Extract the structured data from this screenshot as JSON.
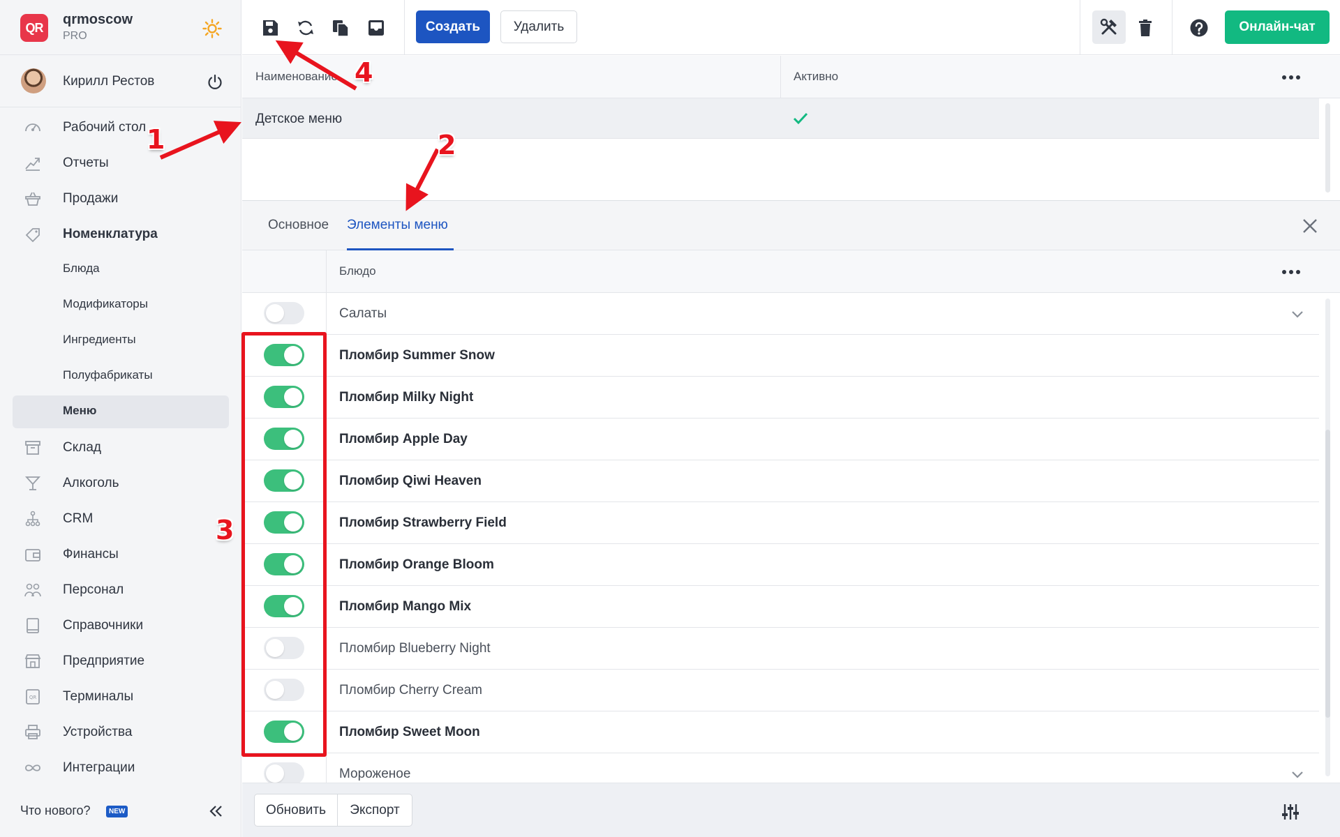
{
  "brand": {
    "logo_text": "QR",
    "name": "qrmoscow",
    "plan": "PRO"
  },
  "user": {
    "name": "Кирилл Рестов"
  },
  "nav": {
    "items": [
      {
        "label": "Рабочий стол",
        "icon": "dashboard-gauge-icon"
      },
      {
        "label": "Отчеты",
        "icon": "chart-trend-icon"
      },
      {
        "label": "Продажи",
        "icon": "basket-icon"
      },
      {
        "label": "Номенклатура",
        "icon": "tag-icon"
      }
    ],
    "sub": [
      "Блюда",
      "Модификаторы",
      "Ингредиенты",
      "Полуфабрикаты",
      "Меню"
    ],
    "active_sub": "Меню",
    "items_after": [
      {
        "label": "Склад",
        "icon": "archive-icon"
      },
      {
        "label": "Алкоголь",
        "icon": "cocktail-icon"
      },
      {
        "label": "CRM",
        "icon": "hierarchy-icon"
      },
      {
        "label": "Финансы",
        "icon": "wallet-icon"
      },
      {
        "label": "Персонал",
        "icon": "people-icon"
      },
      {
        "label": "Справочники",
        "icon": "book-icon"
      },
      {
        "label": "Предприятие",
        "icon": "store-icon"
      },
      {
        "label": "Терминалы",
        "icon": "qr-terminal-icon"
      },
      {
        "label": "Устройства",
        "icon": "printer-icon"
      },
      {
        "label": "Интеграции",
        "icon": "infinity-icon"
      }
    ],
    "whats_new": "Что нового?",
    "new_badge": "NEW"
  },
  "toolbar": {
    "create_label": "Создать",
    "delete_label": "Удалить",
    "chat_label": "Онлайн-чат"
  },
  "top_grid": {
    "columns": [
      "Наименование",
      "Активно"
    ],
    "rows": [
      {
        "name": "Детское меню",
        "active": true
      }
    ]
  },
  "detail": {
    "tabs": [
      "Основное",
      "Элементы меню"
    ],
    "active_tab": 1,
    "column": "Блюдо",
    "rows": [
      {
        "name": "Салаты",
        "enabled": false,
        "group": true
      },
      {
        "name": "Пломбир Summer Snow",
        "enabled": true
      },
      {
        "name": "Пломбир Milky Night",
        "enabled": true
      },
      {
        "name": "Пломбир Apple Day",
        "enabled": true
      },
      {
        "name": "Пломбир Qiwi Heaven",
        "enabled": true
      },
      {
        "name": "Пломбир Strawberry Field",
        "enabled": true
      },
      {
        "name": "Пломбир Orange Bloom",
        "enabled": true
      },
      {
        "name": "Пломбир Mango Mix",
        "enabled": true
      },
      {
        "name": "Пломбир Blueberry Night",
        "enabled": false
      },
      {
        "name": "Пломбир Cherry Cream",
        "enabled": false
      },
      {
        "name": "Пломбир Sweet Moon",
        "enabled": true
      },
      {
        "name": "Мороженое",
        "enabled": false,
        "group": true
      }
    ],
    "footer": {
      "refresh_label": "Обновить",
      "export_label": "Экспорт"
    }
  },
  "annotations": {
    "labels": [
      "1",
      "2",
      "3",
      "4"
    ],
    "color": "#e8141e"
  },
  "colors": {
    "primary": "#1d55c1",
    "success": "#12b981",
    "toggle_on": "#3cbf7c",
    "logo": "#e8364a"
  }
}
